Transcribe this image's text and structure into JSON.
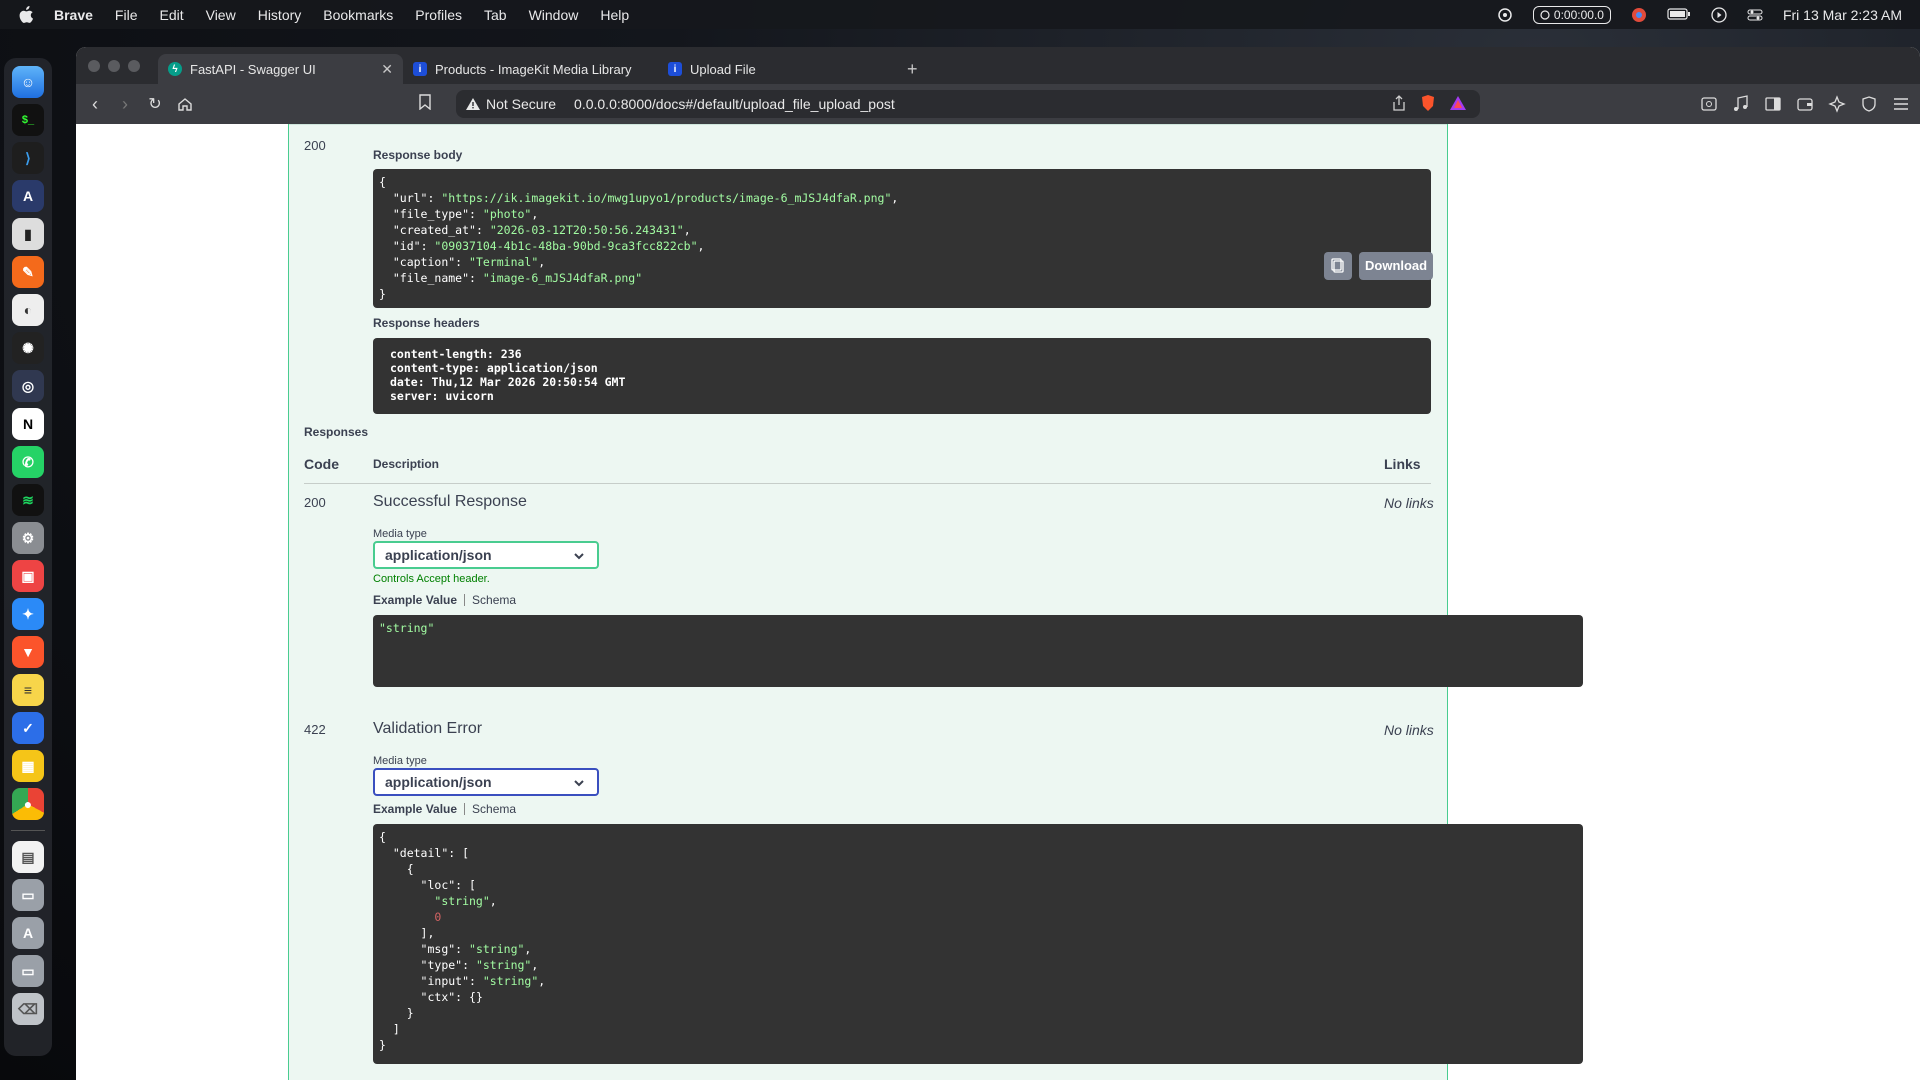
{
  "menubar": {
    "app_name": "Brave",
    "items": [
      "File",
      "Edit",
      "View",
      "History",
      "Bookmarks",
      "Profiles",
      "Tab",
      "Window",
      "Help"
    ],
    "timer": "0:00:00.0",
    "datetime": "Fri 13 Mar  2:23 AM"
  },
  "browser": {
    "tabs": [
      {
        "title": "FastAPI - Swagger UI",
        "active": true
      },
      {
        "title": "Products - ImageKit Media Library",
        "active": false
      },
      {
        "title": "Upload File",
        "active": false
      }
    ],
    "security_label": "Not Secure",
    "url": "0.0.0.0:8000/docs#/default/upload_file_upload_post"
  },
  "result": {
    "status_code": "200",
    "response_body_label": "Response body",
    "response_body": {
      "url": "https://ik.imagekit.io/mwg1upyo1/products/image-6_mJSJ4dfaR.png",
      "file_type": "photo",
      "created_at": "2026-03-12T20:50:56.243431",
      "id": "09037104-4b1c-48ba-90bd-9ca3fcc822cb",
      "caption": "Terminal",
      "file_name": "image-6_mJSJ4dfaR.png"
    },
    "download_label": "Download",
    "response_headers_label": "Response headers",
    "response_headers": [
      "content-length: 236",
      "content-type: application/json",
      "date: Thu,12 Mar 2026 20:50:54 GMT",
      "server: uvicorn"
    ]
  },
  "responses": {
    "heading": "Responses",
    "col_code": "Code",
    "col_description": "Description",
    "col_links": "Links",
    "rows": [
      {
        "code": "200",
        "description": "Successful Response",
        "links": "No links",
        "media_type_label": "Media type",
        "media_type": "application/json",
        "accept_note": "Controls Accept header.",
        "example_tab": "Example Value",
        "schema_tab": "Schema",
        "example": "\"string\""
      },
      {
        "code": "422",
        "description": "Validation Error",
        "links": "No links",
        "media_type_label": "Media type",
        "media_type": "application/json",
        "example_tab": "Example Value",
        "schema_tab": "Schema"
      }
    ]
  },
  "colors": {
    "accent_green": "#49cc90",
    "json_string": "#a2fca2",
    "json_number": "#d36363",
    "code_bg": "#333333"
  }
}
